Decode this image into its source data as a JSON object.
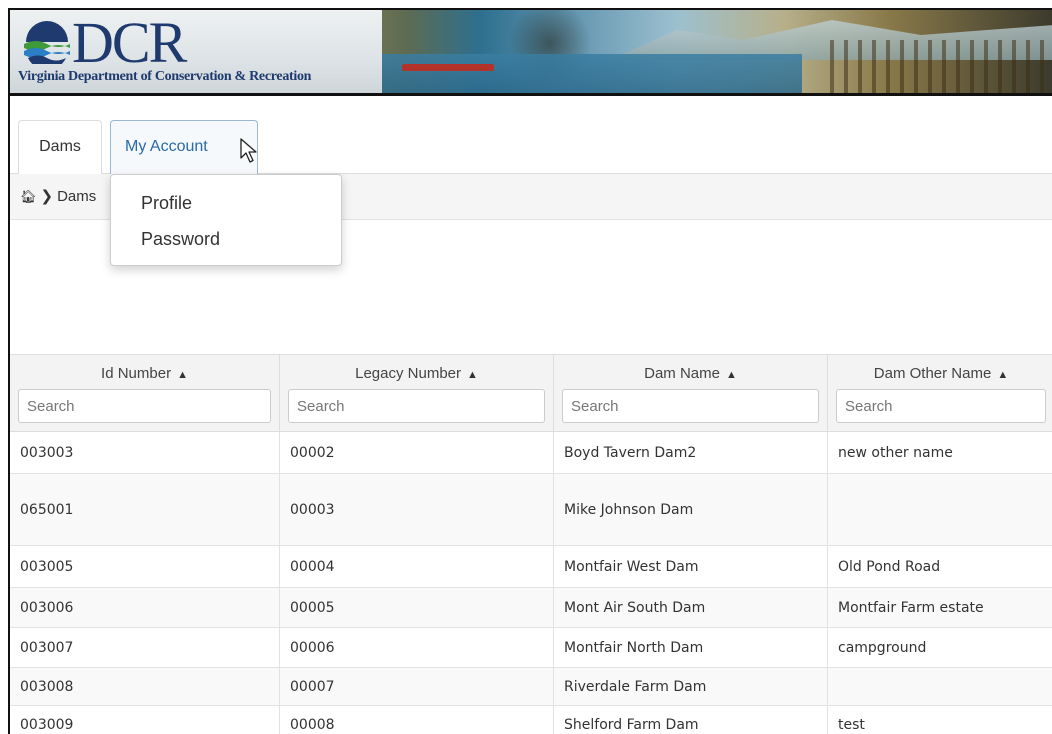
{
  "banner": {
    "logo_text": "DCR",
    "logo_subtitle": "Virginia Department of Conservation & Recreation"
  },
  "nav": {
    "tabs": [
      {
        "label": "Dams"
      },
      {
        "label": "My Account"
      }
    ],
    "dropdown": {
      "items": [
        {
          "label": "Profile"
        },
        {
          "label": "Password"
        }
      ]
    }
  },
  "breadcrumb": {
    "home_icon": "home-icon",
    "current": "Dams"
  },
  "table": {
    "columns": [
      {
        "label": "Id Number",
        "placeholder": "Search"
      },
      {
        "label": "Legacy Number",
        "placeholder": "Search"
      },
      {
        "label": "Dam Name",
        "placeholder": "Search"
      },
      {
        "label": "Dam Other Name",
        "placeholder": "Search"
      }
    ],
    "rows": [
      [
        "003003",
        "00002",
        "Boyd Tavern Dam2",
        "new other name"
      ],
      [
        "065001",
        "00003",
        "Mike Johnson Dam",
        ""
      ],
      [
        "003005",
        "00004",
        "Montfair West Dam",
        "Old Pond Road"
      ],
      [
        "003006",
        "00005",
        "Mont Air South Dam",
        "Montfair Farm estate"
      ],
      [
        "003007",
        "00006",
        "Montfair North Dam",
        "campground"
      ],
      [
        "003008",
        "00007",
        "Riverdale Farm Dam",
        ""
      ],
      [
        "003009",
        "00008",
        "Shelford Farm Dam",
        "test"
      ]
    ]
  },
  "colors": {
    "brand_navy": "#1f3a6e",
    "link_blue": "#2a6aa8",
    "header_bg": "#f3f3f3"
  }
}
